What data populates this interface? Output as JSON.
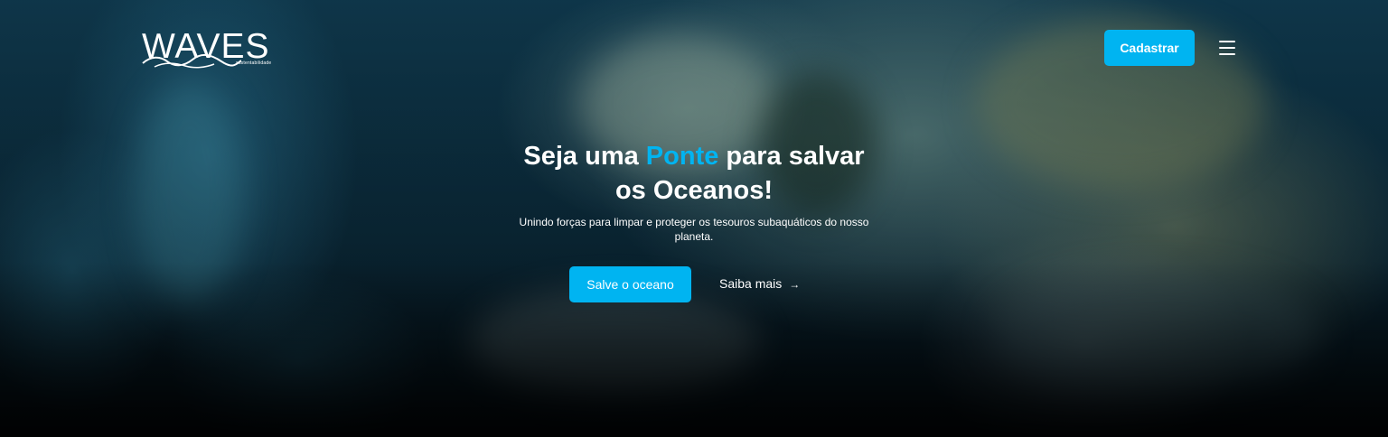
{
  "header": {
    "logo": {
      "text": "WAVES",
      "tagline": "sustentabilidade",
      "icon": "waves-logo-icon"
    },
    "signup_label": "Cadastrar",
    "menu_icon": "hamburger-menu-icon"
  },
  "hero": {
    "title_before": "Seja uma ",
    "title_accent": "Ponte",
    "title_after": " para salvar os Oceanos!",
    "subtitle": "Unindo forças para limpar e proteger os tesouros subaquáticos do nosso planeta.",
    "primary_cta": "Salve o oceano",
    "secondary_cta": "Saiba mais",
    "secondary_icon": "arrow-right-icon"
  },
  "colors": {
    "accent": "#00b4f1",
    "text": "#ffffff"
  }
}
